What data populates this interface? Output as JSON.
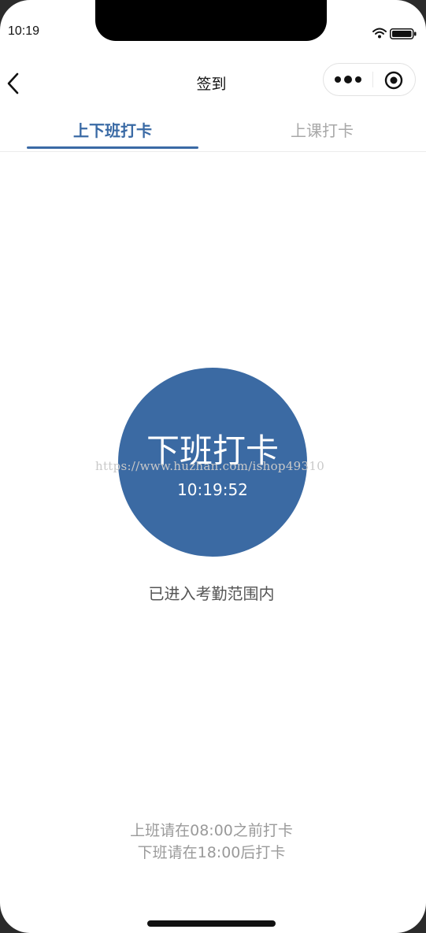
{
  "status_bar": {
    "time": "10:19"
  },
  "nav": {
    "title": "签到"
  },
  "tabs": [
    {
      "label": "上下班打卡",
      "active": true
    },
    {
      "label": "上课打卡",
      "active": false
    }
  ],
  "punch": {
    "label": "下班打卡",
    "time": "10:19:52"
  },
  "watermark": "https://www.huzhan.com/ishop49310",
  "range_status": "已进入考勤范围内",
  "rules": [
    "上班请在08:00之前打卡",
    "下班请在18:00后打卡"
  ],
  "colors": {
    "accent": "#3a6aa5",
    "punch_circle": "#3b6aa3"
  }
}
